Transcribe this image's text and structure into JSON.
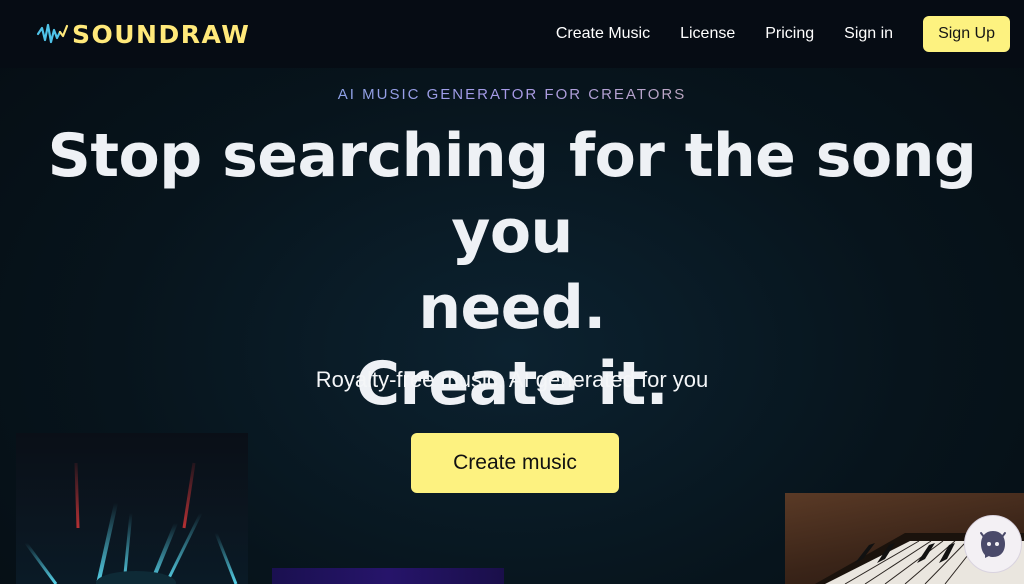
{
  "brand": {
    "name": "SOUNDRAW",
    "logo_icon": "sound-wave-icon"
  },
  "nav": {
    "links": [
      "Create Music",
      "License",
      "Pricing",
      "Sign in"
    ],
    "signup_label": "Sign Up"
  },
  "hero": {
    "eyebrow": "AI MUSIC GENERATOR FOR CREATORS",
    "headline_line1": "Stop searching for the song you",
    "headline_line2": "need.",
    "headline_line3": "Create it.",
    "subhead": "Royalty-free music, AI generated for you",
    "cta_label": "Create music"
  },
  "colors": {
    "accent": "#fdf280",
    "background": "#07141c",
    "nav_background": "#060c14"
  },
  "chat_widget": {
    "icon": "chat-bot-icon"
  }
}
